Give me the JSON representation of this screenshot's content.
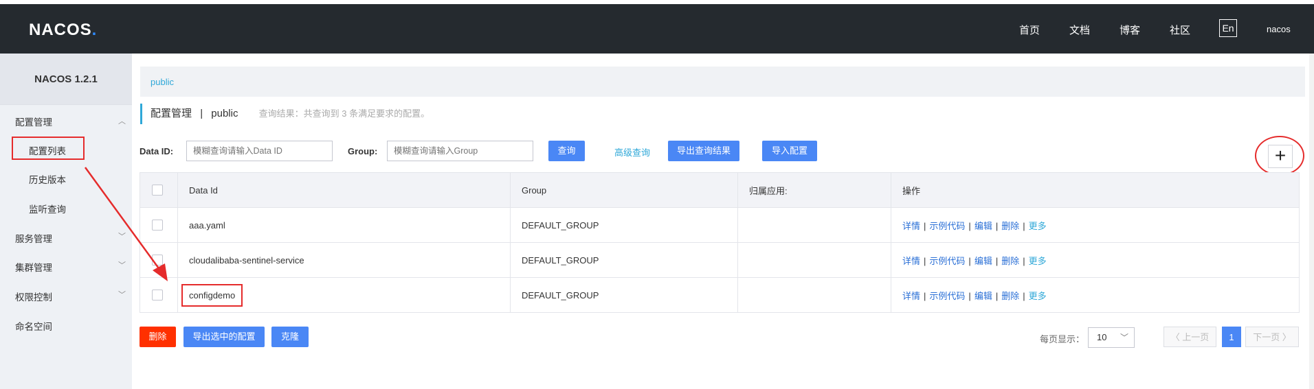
{
  "header": {
    "logo": "NACOS",
    "logo_dot": ".",
    "nav": [
      "首页",
      "文档",
      "博客",
      "社区"
    ],
    "lang": "En",
    "user": "nacos"
  },
  "sidebar": {
    "version": "NACOS 1.2.1",
    "config_mgmt": "配置管理",
    "config_list": "配置列表",
    "history": "历史版本",
    "listen_query": "监听查询",
    "service_mgmt": "服务管理",
    "cluster_mgmt": "集群管理",
    "access_ctrl": "权限控制",
    "namespace": "命名空间"
  },
  "main": {
    "namespace_tab": "public",
    "title": "配置管理",
    "title_sep": "|",
    "title_ns": "public",
    "result_text": "查询结果：共查询到 3 条满足要求的配置。",
    "data_id_label": "Data ID:",
    "data_id_placeholder": "模糊查询请输入Data ID",
    "group_label": "Group:",
    "group_placeholder": "模糊查询请输入Group",
    "query_btn": "查询",
    "advanced_query": "高级查询",
    "export_result_btn": "导出查询结果",
    "import_btn": "导入配置",
    "plus": "+"
  },
  "table": {
    "headers": [
      "Data Id",
      "Group",
      "归属应用:",
      "操作"
    ],
    "rows": [
      {
        "data_id": "aaa.yaml",
        "group": "DEFAULT_GROUP",
        "app": ""
      },
      {
        "data_id": "cloudalibaba-sentinel-service",
        "group": "DEFAULT_GROUP",
        "app": ""
      },
      {
        "data_id": "configdemo",
        "group": "DEFAULT_GROUP",
        "app": ""
      }
    ],
    "ops": {
      "detail": "详情",
      "sample": "示例代码",
      "edit": "编辑",
      "delete": "删除",
      "more": "更多",
      "sep": "|"
    }
  },
  "footer": {
    "delete_btn": "删除",
    "export_selected_btn": "导出选中的配置",
    "clone_btn": "克隆",
    "page_size_label": "每页显示：",
    "page_size": "10",
    "prev": "〈 上一页",
    "current_page": "1",
    "next": "下一页 〉"
  },
  "colors": {
    "header_bg": "#252a2f",
    "primary": "#4a87f5",
    "link": "#2fa8d8",
    "danger": "#ff3000",
    "annotation": "#e52b2b"
  }
}
